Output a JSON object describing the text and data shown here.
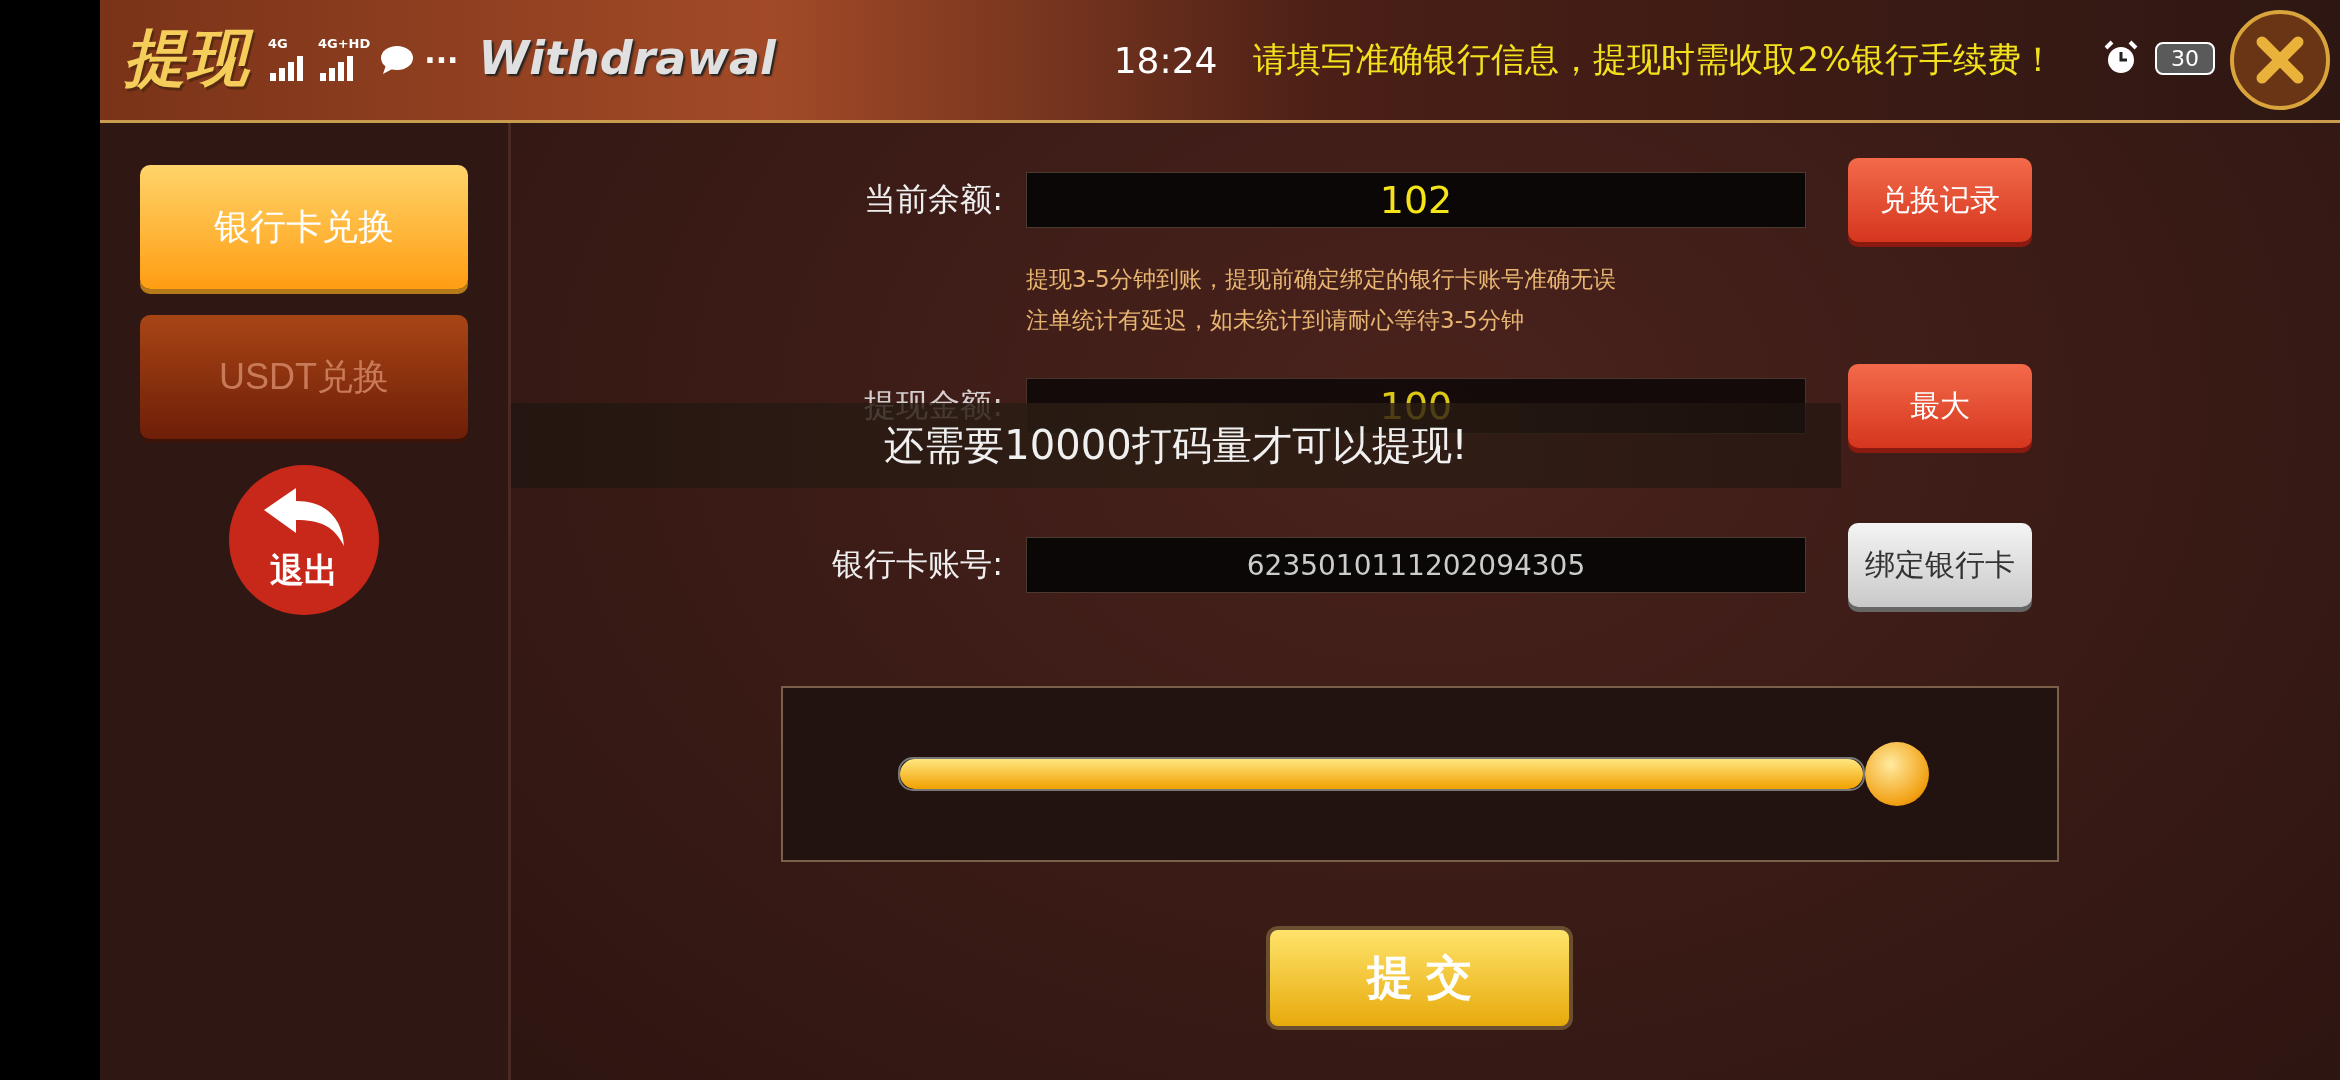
{
  "status_bar": {
    "time": "18:24",
    "network_labels": [
      "4G",
      "4G+HD"
    ],
    "more": "···",
    "battery": "30"
  },
  "header": {
    "title": "提现",
    "subtitle": "Withdrawal",
    "notice": "请填写准确银行信息，提现时需收取2%银行手续费！"
  },
  "sidebar": {
    "tabs": [
      {
        "label": "银行卡兑换",
        "selected": true
      },
      {
        "label": "USDT兑换",
        "selected": false
      }
    ],
    "exit_button": "退出"
  },
  "form": {
    "rows": [
      {
        "label": "当前余额:",
        "value": "102",
        "highlighted": true,
        "button": "兑换记录",
        "kind": "primary"
      },
      {
        "label": "提现金额:",
        "value": "100",
        "highlighted": true,
        "button": "最大",
        "kind": "primary"
      },
      {
        "label": "银行卡账号:",
        "value": "6235010111202094305",
        "highlighted": false,
        "button": "绑定银行卡",
        "kind": "secondary"
      }
    ],
    "hints": [
      "提现3-5分钟到账，提现前确定绑定的银行卡账号准确无误",
      "注单统计有延迟，如未统计到请耐心等待3-5分钟"
    ]
  },
  "slider": {
    "level": 1
  },
  "submit_button": "提 交",
  "toast": "还需要10000打码量才可以提现!"
}
